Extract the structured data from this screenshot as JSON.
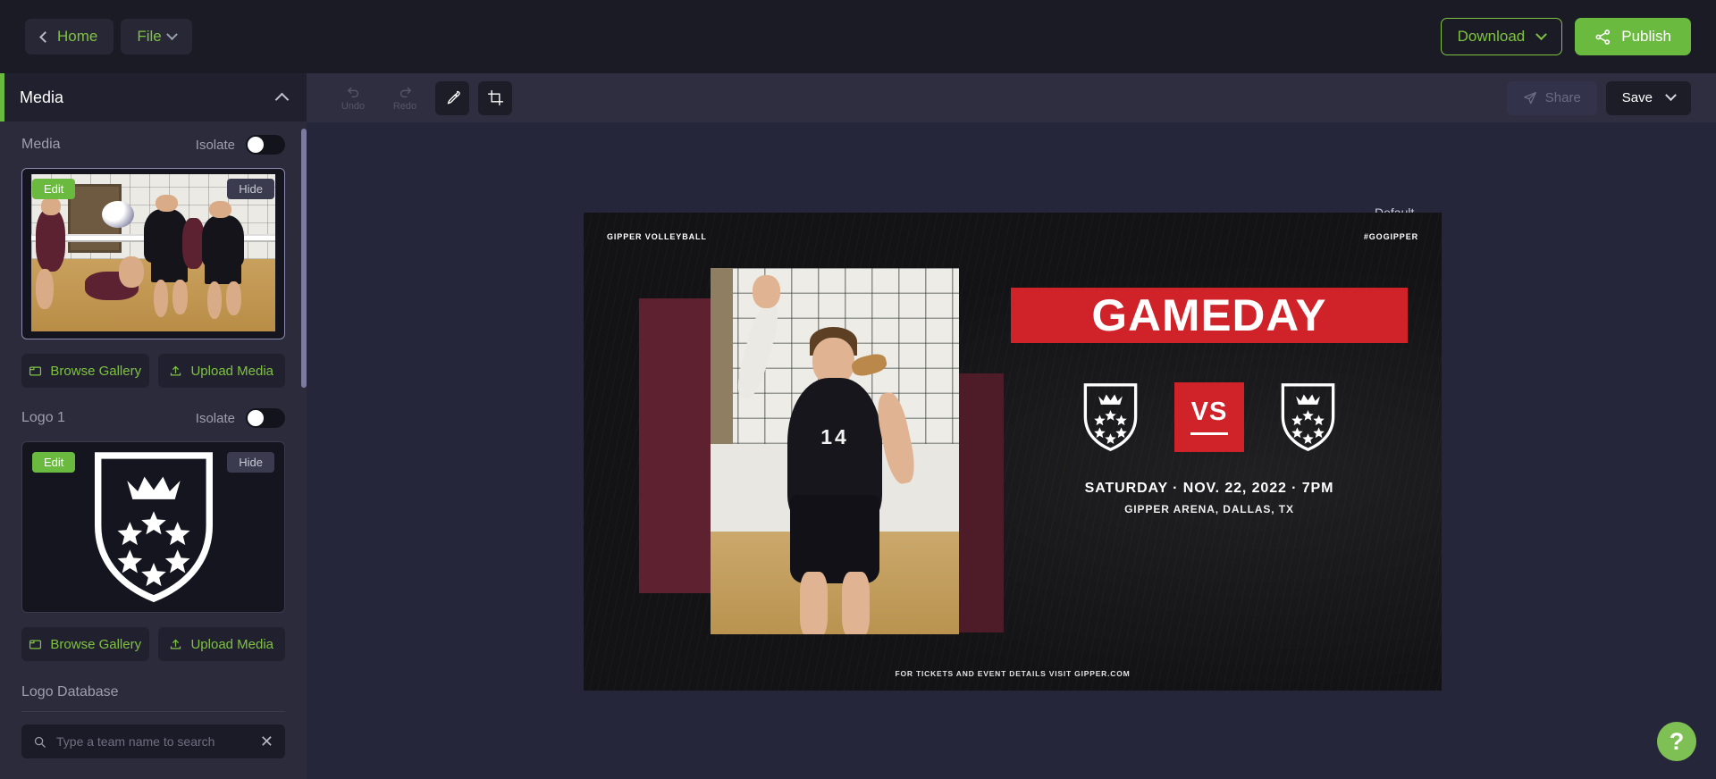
{
  "topbar": {
    "home_label": "Home",
    "file_label": "File",
    "download_label": "Download",
    "publish_label": "Publish"
  },
  "sidebar": {
    "panel_title": "Media",
    "media_section": {
      "label": "Media",
      "isolate_label": "Isolate",
      "isolate_on": false,
      "edit_label": "Edit",
      "hide_label": "Hide",
      "browse_label": "Browse Gallery",
      "upload_label": "Upload Media"
    },
    "logo_section": {
      "label": "Logo 1",
      "isolate_label": "Isolate",
      "isolate_on": false,
      "edit_label": "Edit",
      "hide_label": "Hide",
      "browse_label": "Browse Gallery",
      "upload_label": "Upload Media"
    },
    "logo_database": {
      "label": "Logo Database",
      "search_placeholder": "Type a team name to search",
      "search_value": ""
    }
  },
  "editor": {
    "toolbar": {
      "undo_label": "Undo",
      "redo_label": "Redo",
      "undo_enabled": false,
      "redo_enabled": false,
      "eyedropper_name": "eyedropper-tool",
      "crop_name": "crop-tool",
      "share_label": "Share",
      "share_enabled": false,
      "save_label": "Save"
    },
    "canvas_tag": "Default"
  },
  "graphic": {
    "top_left": "GIPPER VOLLEYBALL",
    "top_right": "#GOGIPPER",
    "headline": "GAMEDAY",
    "vs_label": "VS",
    "player_number": "14",
    "date_line": "SATURDAY · NOV. 22, 2022 · 7PM",
    "venue_line": "GIPPER ARENA, DALLAS, TX",
    "footer": "FOR TICKETS AND EVENT DETAILS VISIT GIPPER.COM"
  },
  "help": {
    "label": "?"
  },
  "colors": {
    "brand_green": "#6aba3f",
    "accent_red": "#cf2229",
    "sidebar_bg": "#2b2b3c",
    "topbar_bg": "#1b1b26",
    "editor_bg": "#26263a",
    "canvas_bg": "#131315"
  }
}
